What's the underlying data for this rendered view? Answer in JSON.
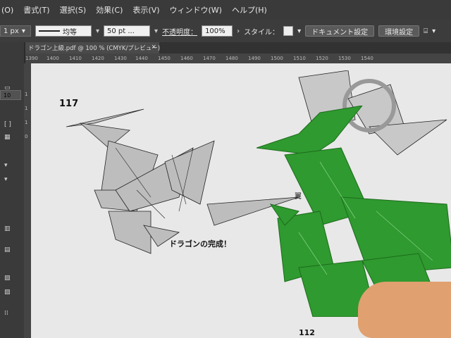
{
  "menubar": {
    "items": [
      "(O)",
      "書式(T)",
      "選択(S)",
      "効果(C)",
      "表示(V)",
      "ウィンドウ(W)",
      "ヘルプ(H)"
    ]
  },
  "controlbar": {
    "stroke_weight": "1 px",
    "stroke_profile": "均等",
    "brush": "50 pt ...",
    "opacity_label": "不透明度：",
    "opacity_value": "100%",
    "style_label": "スタイル：",
    "document_settings": "ドキュメント設定",
    "preferences": "環境設定"
  },
  "document_tab": {
    "title": "ドラゴン上級.pdf @ 100 % (CMYK/プレビュー)",
    "close": "×"
  },
  "ruler": {
    "ticks": [
      "1390",
      "1400",
      "1410",
      "1420",
      "1430",
      "1440",
      "1450",
      "1460",
      "1470",
      "1480",
      "1490",
      "1500",
      "1510",
      "1520",
      "1530",
      "1540"
    ]
  },
  "vruler": {
    "ticks": [
      "1",
      "1",
      "1",
      "0"
    ]
  },
  "left_panel": {
    "value": "10"
  },
  "page": {
    "number_top": "117",
    "caption": "ドラゴンの完成！",
    "number_bottom": "112",
    "side_char": "翼"
  }
}
